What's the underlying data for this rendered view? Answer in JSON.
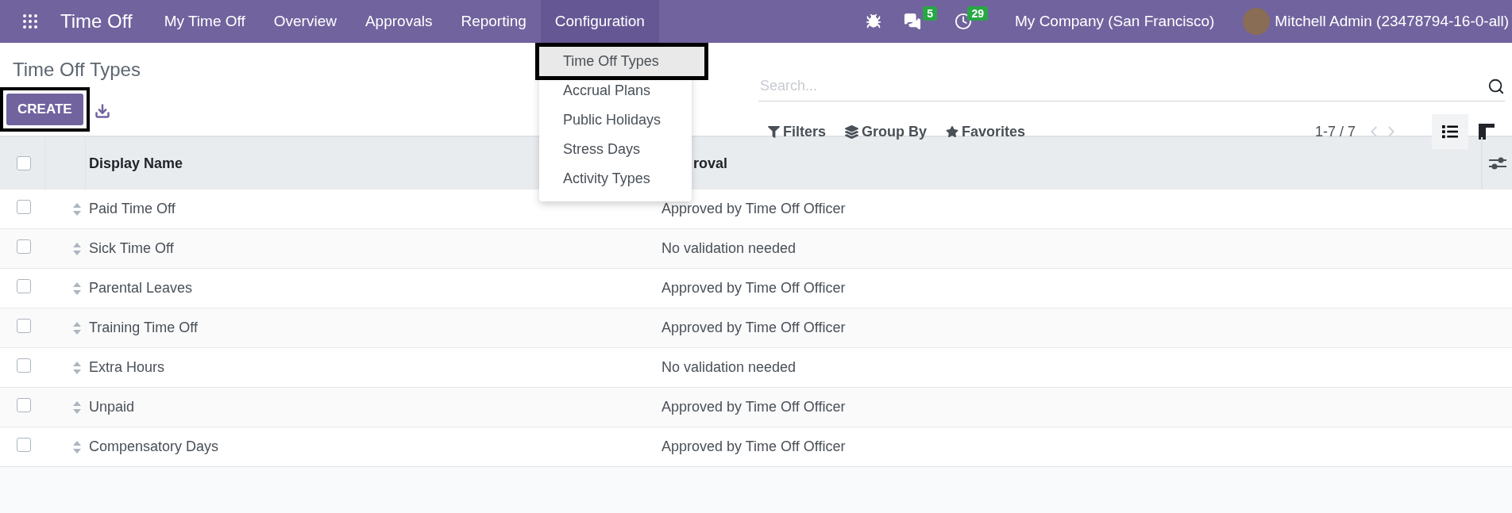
{
  "navbar": {
    "app_title": "Time Off",
    "menus": [
      {
        "label": "My Time Off",
        "selected": false
      },
      {
        "label": "Overview",
        "selected": false
      },
      {
        "label": "Approvals",
        "selected": false
      },
      {
        "label": "Reporting",
        "selected": false
      },
      {
        "label": "Configuration",
        "selected": true
      }
    ],
    "messages_badge": "5",
    "activities_badge": "29",
    "company": "My Company (San Francisco)",
    "user": "Mitchell Admin (23478794-16-0-all)"
  },
  "dropdown": {
    "items": [
      {
        "label": "Time Off Types",
        "selected": true,
        "highlighted": true
      },
      {
        "label": "Accrual Plans",
        "selected": false,
        "highlighted": false
      },
      {
        "label": "Public Holidays",
        "selected": false,
        "highlighted": false
      },
      {
        "label": "Stress Days",
        "selected": false,
        "highlighted": false
      },
      {
        "label": "Activity Types",
        "selected": false,
        "highlighted": false
      }
    ]
  },
  "control_panel": {
    "title": "Time Off Types",
    "create_button": {
      "label": "CREATE",
      "highlighted": true
    },
    "search": {
      "placeholder": "Search..."
    },
    "filters": [
      "Filters",
      "Group By",
      "Favorites"
    ],
    "pager": "1-7 / 7",
    "views": [
      {
        "kind": "list",
        "selected": true
      },
      {
        "kind": "kanban",
        "selected": false
      }
    ]
  },
  "table": {
    "select_all_checked": false,
    "columns": [
      "Display Name",
      "roval"
    ],
    "rows": [
      {
        "checked": false,
        "name": "Paid Time Off",
        "approval": "Approved by Time Off Officer"
      },
      {
        "checked": false,
        "name": "Sick Time Off",
        "approval": "No validation needed"
      },
      {
        "checked": false,
        "name": "Parental Leaves",
        "approval": "Approved by Time Off Officer"
      },
      {
        "checked": false,
        "name": "Training Time Off",
        "approval": "Approved by Time Off Officer"
      },
      {
        "checked": false,
        "name": "Extra Hours",
        "approval": "No validation needed"
      },
      {
        "checked": false,
        "name": "Unpaid",
        "approval": "Approved by Time Off Officer"
      },
      {
        "checked": false,
        "name": "Compensatory Days",
        "approval": "Approved by Time Off Officer"
      }
    ]
  }
}
